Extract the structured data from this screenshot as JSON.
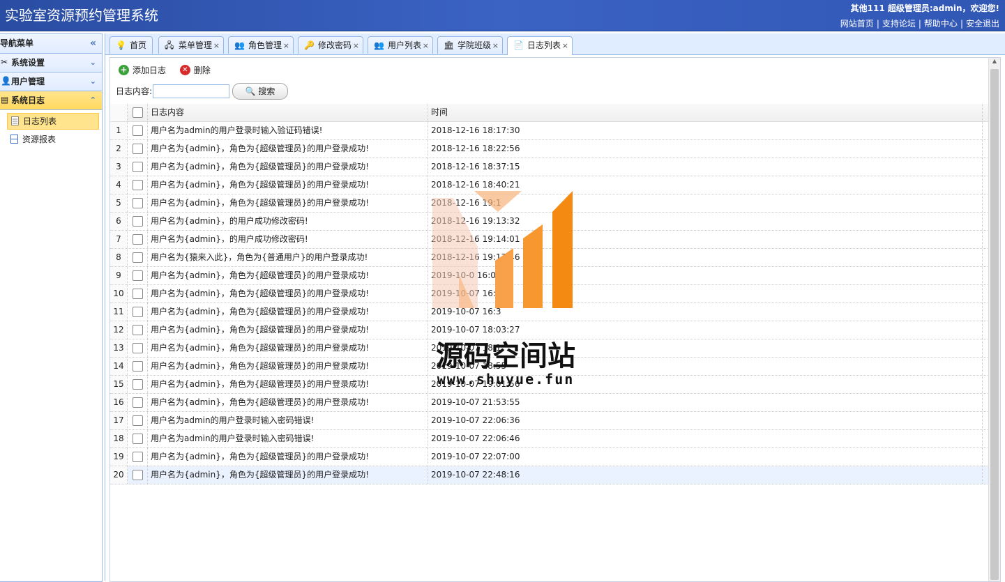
{
  "header": {
    "title": "实验室资源预约管理系统",
    "user_text": "其他111 超级管理员:admin，欢迎您!",
    "links": [
      "网站首页",
      "支持论坛",
      "帮助中心",
      "安全退出"
    ]
  },
  "sidebar": {
    "title": "导航菜单",
    "groups": [
      {
        "label": "系统设置",
        "icon": "tools-icon"
      },
      {
        "label": "用户管理",
        "icon": "user-icon"
      },
      {
        "label": "系统日志",
        "icon": "log-icon",
        "expanded": true
      }
    ],
    "items": [
      {
        "label": "日志列表",
        "selected": true
      },
      {
        "label": "资源报表"
      }
    ]
  },
  "tabs": [
    {
      "label": "首页",
      "icon": "bulb-icon",
      "closable": false
    },
    {
      "label": "菜单管理",
      "icon": "tree-icon",
      "closable": true
    },
    {
      "label": "角色管理",
      "icon": "users-icon",
      "closable": true
    },
    {
      "label": "修改密码",
      "icon": "key-icon",
      "closable": true
    },
    {
      "label": "用户列表",
      "icon": "users-icon",
      "closable": true
    },
    {
      "label": "学院班级",
      "icon": "building-icon",
      "closable": true
    },
    {
      "label": "日志列表",
      "icon": "doc-icon",
      "closable": true,
      "active": true
    }
  ],
  "toolbar": {
    "add_label": "添加日志",
    "delete_label": "删除"
  },
  "search": {
    "label": "日志内容:",
    "value": "",
    "button_label": "搜索"
  },
  "grid": {
    "columns": [
      "日志内容",
      "时间"
    ],
    "rows": [
      {
        "num": "1",
        "content": "用户名为admin的用户登录时输入验证码错误!",
        "time": "2018-12-16 18:17:30"
      },
      {
        "num": "2",
        "content": "用户名为{admin}，角色为{超级管理员}的用户登录成功!",
        "time": "2018-12-16 18:22:56"
      },
      {
        "num": "3",
        "content": "用户名为{admin}，角色为{超级管理员}的用户登录成功!",
        "time": "2018-12-16 18:37:15"
      },
      {
        "num": "4",
        "content": "用户名为{admin}，角色为{超级管理员}的用户登录成功!",
        "time": "2018-12-16 18:40:21"
      },
      {
        "num": "5",
        "content": "用户名为{admin}，角色为{超级管理员}的用户登录成功!",
        "time": "2018-12-16 19:1"
      },
      {
        "num": "6",
        "content": "用户名为{admin}，的用户成功修改密码!",
        "time": "2018-12-16 19:13:32"
      },
      {
        "num": "7",
        "content": "用户名为{admin}，的用户成功修改密码!",
        "time": "2018-12-16 19:14:01"
      },
      {
        "num": "8",
        "content": "用户名为{猿来入此}，角色为{普通用户}的用户登录成功!",
        "time": "2018-12-16 19:17:46"
      },
      {
        "num": "9",
        "content": "用户名为{admin}，角色为{超级管理员}的用户登录成功!",
        "time": "2019-10-0 16:05"
      },
      {
        "num": "10",
        "content": "用户名为{admin}，角色为{超级管理员}的用户登录成功!",
        "time": "2019-10-07 16:3"
      },
      {
        "num": "11",
        "content": "用户名为{admin}，角色为{超级管理员}的用户登录成功!",
        "time": "2019-10-07 16:3"
      },
      {
        "num": "12",
        "content": "用户名为{admin}，角色为{超级管理员}的用户登录成功!",
        "time": "2019-10-07 18:03:27"
      },
      {
        "num": "13",
        "content": "用户名为{admin}，角色为{超级管理员}的用户登录成功!",
        "time": "2019-10-07 18:1"
      },
      {
        "num": "14",
        "content": "用户名为{admin}，角色为{超级管理员}的用户登录成功!",
        "time": "2019-10-07 18:55"
      },
      {
        "num": "15",
        "content": "用户名为{admin}，角色为{超级管理员}的用户登录成功!",
        "time": "2019-10-07 19:01:56"
      },
      {
        "num": "16",
        "content": "用户名为{admin}，角色为{超级管理员}的用户登录成功!",
        "time": "2019-10-07 21:53:55"
      },
      {
        "num": "17",
        "content": "用户名为admin的用户登录时输入密码错误!",
        "time": "2019-10-07 22:06:36"
      },
      {
        "num": "18",
        "content": "用户名为admin的用户登录时输入密码错误!",
        "time": "2019-10-07 22:06:46"
      },
      {
        "num": "19",
        "content": "用户名为{admin}，角色为{超级管理员}的用户登录成功!",
        "time": "2019-10-07 22:07:00"
      },
      {
        "num": "20",
        "content": "用户名为{admin}，角色为{超级管理员}的用户登录成功!",
        "time": "2019-10-07 22:48:16",
        "highlighted": true
      }
    ]
  },
  "watermark": {
    "text": "源码空间站",
    "url": "www.shuyue.fun"
  },
  "colors": {
    "header_bg": "#2a4da3",
    "border": "#95b8e7",
    "active_group": "#ffd95f",
    "watermark_orange": "#f7931e"
  }
}
